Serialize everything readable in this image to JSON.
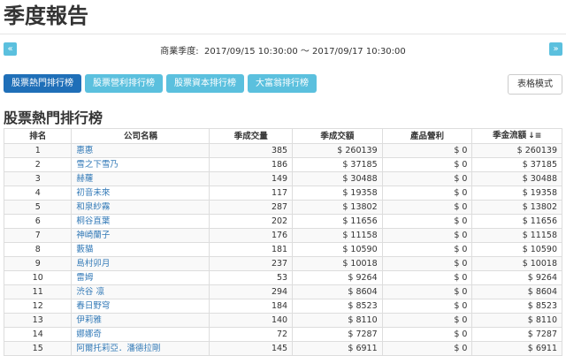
{
  "page": {
    "title": "季度報告"
  },
  "range": {
    "prev": "«",
    "next": "»",
    "label": "商業季度:",
    "text": "2017/09/15 10:30:00 ～ 2017/09/17 10:30:00"
  },
  "tabs": [
    {
      "label": "股票熱門排行榜",
      "active": true
    },
    {
      "label": "股票營利排行榜",
      "active": false
    },
    {
      "label": "股票資本排行榜",
      "active": false
    },
    {
      "label": "大富翁排行榜",
      "active": false
    }
  ],
  "mode_button": "表格模式",
  "section_title": "股票熱門排行榜",
  "table": {
    "headers": [
      "排名",
      "公司名稱",
      "季成交量",
      "季成交額",
      "產品營利",
      "季金流額"
    ],
    "sort_icon": "sort-desc-icon",
    "rows": [
      [
        "1",
        "惠惠",
        "385",
        "$ 260139",
        "$ 0",
        "$ 260139"
      ],
      [
        "2",
        "雪之下雪乃",
        "186",
        "$ 37185",
        "$ 0",
        "$ 37185"
      ],
      [
        "3",
        "赫蘿",
        "149",
        "$ 30488",
        "$ 0",
        "$ 30488"
      ],
      [
        "4",
        "初音未來",
        "117",
        "$ 19358",
        "$ 0",
        "$ 19358"
      ],
      [
        "5",
        "和泉紗霧",
        "287",
        "$ 13802",
        "$ 0",
        "$ 13802"
      ],
      [
        "6",
        "桐谷直葉",
        "202",
        "$ 11656",
        "$ 0",
        "$ 11656"
      ],
      [
        "7",
        "神崎蘭子",
        "176",
        "$ 11158",
        "$ 0",
        "$ 11158"
      ],
      [
        "8",
        "藪貓",
        "181",
        "$ 10590",
        "$ 0",
        "$ 10590"
      ],
      [
        "9",
        "島村卯月",
        "237",
        "$ 10018",
        "$ 0",
        "$ 10018"
      ],
      [
        "10",
        "雷姆",
        "53",
        "$ 9264",
        "$ 0",
        "$ 9264"
      ],
      [
        "11",
        "渋谷 凛",
        "294",
        "$ 8604",
        "$ 0",
        "$ 8604"
      ],
      [
        "12",
        "春日野穹",
        "184",
        "$ 8523",
        "$ 0",
        "$ 8523"
      ],
      [
        "13",
        "伊莉雅",
        "140",
        "$ 8110",
        "$ 0",
        "$ 8110"
      ],
      [
        "14",
        "娜娜奇",
        "72",
        "$ 7287",
        "$ 0",
        "$ 7287"
      ],
      [
        "15",
        "阿爾托莉亞．潘德拉剛",
        "145",
        "$ 6911",
        "$ 0",
        "$ 6911"
      ]
    ]
  }
}
